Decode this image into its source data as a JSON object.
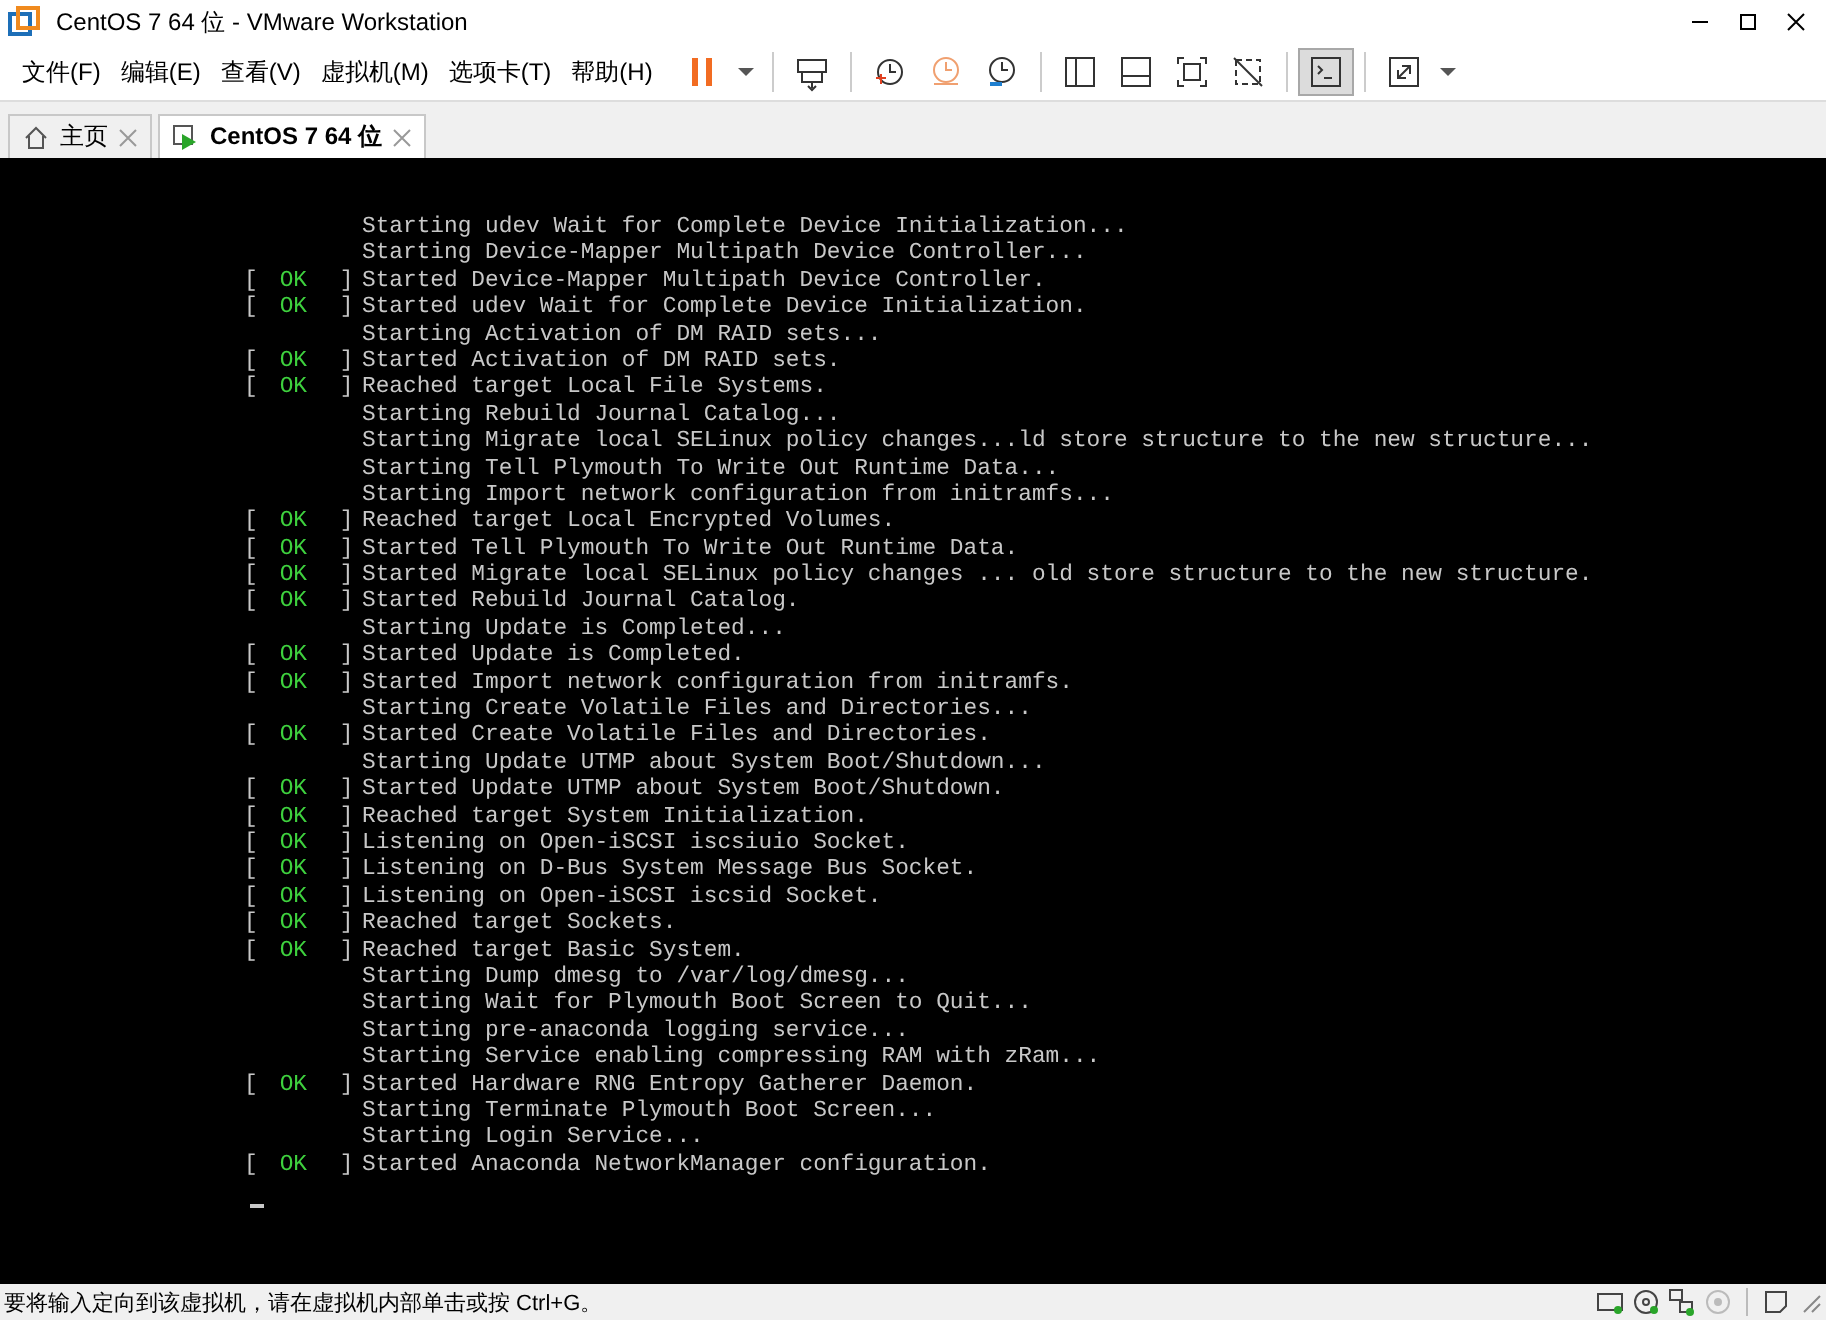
{
  "window": {
    "title": "CentOS 7 64 位 - VMware Workstation"
  },
  "menu": [
    "文件(F)",
    "编辑(E)",
    "查看(V)",
    "虚拟机(M)",
    "选项卡(T)",
    "帮助(H)"
  ],
  "toolbar": [
    {
      "kind": "pause",
      "pressed": false
    },
    {
      "kind": "caret",
      "pressed": false
    },
    {
      "kind": "sep"
    },
    {
      "kind": "sendkeys",
      "pressed": false
    },
    {
      "kind": "sep"
    },
    {
      "kind": "snapshot",
      "pressed": false
    },
    {
      "kind": "revert",
      "pressed": false
    },
    {
      "kind": "manager",
      "pressed": false
    },
    {
      "kind": "sep"
    },
    {
      "kind": "library",
      "pressed": false
    },
    {
      "kind": "thumb",
      "pressed": false
    },
    {
      "kind": "fullscreen",
      "pressed": false
    },
    {
      "kind": "unity",
      "pressed": false
    },
    {
      "kind": "sep"
    },
    {
      "kind": "console",
      "pressed": true
    },
    {
      "kind": "sep"
    },
    {
      "kind": "stretch",
      "pressed": false
    },
    {
      "kind": "caret",
      "pressed": false
    }
  ],
  "tabs": [
    {
      "kind": "home",
      "label": "主页",
      "selected": false
    },
    {
      "kind": "vm",
      "label": "CentOS 7 64 位",
      "selected": true
    }
  ],
  "console": [
    {
      "kind": "plain",
      "text": "Starting udev Wait for Complete Device Initialization..."
    },
    {
      "kind": "plain",
      "text": "Starting Device-Mapper Multipath Device Controller..."
    },
    {
      "kind": "ok",
      "open": "[",
      "status": "OK",
      "close": "]",
      "text": "Started Device-Mapper Multipath Device Controller."
    },
    {
      "kind": "ok",
      "open": "[",
      "status": "OK",
      "close": "]",
      "text": "Started udev Wait for Complete Device Initialization."
    },
    {
      "kind": "plain",
      "text": "Starting Activation of DM RAID sets..."
    },
    {
      "kind": "ok",
      "open": "[",
      "status": "OK",
      "close": "]",
      "text": "Started Activation of DM RAID sets."
    },
    {
      "kind": "ok",
      "open": "[",
      "status": "OK",
      "close": "]",
      "text": "Reached target Local File Systems."
    },
    {
      "kind": "plain",
      "text": "Starting Rebuild Journal Catalog..."
    },
    {
      "kind": "plain",
      "text": "Starting Migrate local SELinux policy changes...ld store structure to the new structure..."
    },
    {
      "kind": "plain",
      "text": "Starting Tell Plymouth To Write Out Runtime Data..."
    },
    {
      "kind": "plain",
      "text": "Starting Import network configuration from initramfs..."
    },
    {
      "kind": "ok",
      "open": "[",
      "status": "OK",
      "close": "]",
      "text": "Reached target Local Encrypted Volumes."
    },
    {
      "kind": "ok",
      "open": "[",
      "status": "OK",
      "close": "]",
      "text": "Started Tell Plymouth To Write Out Runtime Data."
    },
    {
      "kind": "ok",
      "open": "[",
      "status": "OK",
      "close": "]",
      "text": "Started Migrate local SELinux policy changes ... old store structure to the new structure."
    },
    {
      "kind": "ok",
      "open": "[",
      "status": "OK",
      "close": "]",
      "text": "Started Rebuild Journal Catalog."
    },
    {
      "kind": "plain",
      "text": "Starting Update is Completed..."
    },
    {
      "kind": "ok",
      "open": "[",
      "status": "OK",
      "close": "]",
      "text": "Started Update is Completed."
    },
    {
      "kind": "ok",
      "open": "[",
      "status": "OK",
      "close": "]",
      "text": "Started Import network configuration from initramfs."
    },
    {
      "kind": "plain",
      "text": "Starting Create Volatile Files and Directories..."
    },
    {
      "kind": "ok",
      "open": "[",
      "status": "OK",
      "close": "]",
      "text": "Started Create Volatile Files and Directories."
    },
    {
      "kind": "plain",
      "text": "Starting Update UTMP about System Boot/Shutdown..."
    },
    {
      "kind": "ok",
      "open": "[",
      "status": "OK",
      "close": "]",
      "text": "Started Update UTMP about System Boot/Shutdown."
    },
    {
      "kind": "ok",
      "open": "[",
      "status": "OK",
      "close": "]",
      "text": "Reached target System Initialization."
    },
    {
      "kind": "ok",
      "open": "[",
      "status": "OK",
      "close": "]",
      "text": "Listening on Open-iSCSI iscsiuio Socket."
    },
    {
      "kind": "ok",
      "open": "[",
      "status": "OK",
      "close": "]",
      "text": "Listening on D-Bus System Message Bus Socket."
    },
    {
      "kind": "ok",
      "open": "[",
      "status": "OK",
      "close": "]",
      "text": "Listening on Open-iSCSI iscsid Socket."
    },
    {
      "kind": "ok",
      "open": "[",
      "status": "OK",
      "close": "]",
      "text": "Reached target Sockets."
    },
    {
      "kind": "ok",
      "open": "[",
      "status": "OK",
      "close": "]",
      "text": "Reached target Basic System."
    },
    {
      "kind": "plain",
      "text": "Starting Dump dmesg to /var/log/dmesg..."
    },
    {
      "kind": "plain",
      "text": "Starting Wait for Plymouth Boot Screen to Quit..."
    },
    {
      "kind": "plain",
      "text": "Starting pre-anaconda logging service..."
    },
    {
      "kind": "plain",
      "text": "Starting Service enabling compressing RAM with zRam..."
    },
    {
      "kind": "ok",
      "open": "[",
      "status": "OK",
      "close": "]",
      "text": "Started Hardware RNG Entropy Gatherer Daemon."
    },
    {
      "kind": "plain",
      "text": "Starting Terminate Plymouth Boot Screen..."
    },
    {
      "kind": "plain",
      "text": "Starting Login Service..."
    },
    {
      "kind": "ok",
      "open": "[",
      "status": "OK",
      "close": "]",
      "text": "Started Anaconda NetworkManager configuration."
    }
  ],
  "status_bar": {
    "message": "要将输入定向到该虚拟机，请在虚拟机内部单击或按 Ctrl+G。"
  }
}
